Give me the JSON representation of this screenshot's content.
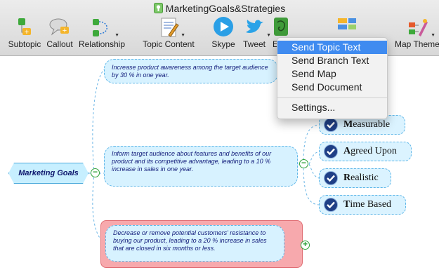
{
  "window": {
    "title": "MarketingGoals&Strategies"
  },
  "toolbar": {
    "items": [
      {
        "label": "Subtopic",
        "icon": "subtopic-icon"
      },
      {
        "label": "Callout",
        "icon": "callout-icon"
      },
      {
        "label": "Relationship",
        "icon": "relationship-icon"
      },
      {
        "label": "Topic Content",
        "icon": "topic-content-icon"
      },
      {
        "label": "Skype",
        "icon": "skype-icon"
      },
      {
        "label": "Tweet",
        "icon": "twitter-bird-icon"
      },
      {
        "label": "E",
        "icon": "evernote-icon"
      },
      {
        "label": "Map Theme",
        "icon": "map-theme-icon"
      }
    ]
  },
  "menu": {
    "items": [
      "Send Topic Text",
      "Send Branch Text",
      "Send Map",
      "Send Document"
    ],
    "settings": "Settings...",
    "highlighted": "Send Topic Text"
  },
  "mindmap": {
    "central": "Marketing Goals",
    "topics": [
      "Increase product awareness among the target audience by 30 % in one year.",
      "Inform target audience about features and benefits of our product and its competitive advantage, leading to a 10 % increase in sales in one year.",
      "Decrease or remove potential customers' resistance to buying our product, leading to a 20 % increase in sales that are closed in six months or less."
    ],
    "smart": [
      {
        "initial": "M",
        "rest": "easurable"
      },
      {
        "initial": "A",
        "rest": "greed Upon"
      },
      {
        "initial": "R",
        "rest": "ealistic"
      },
      {
        "initial": "T",
        "rest": "ime Based"
      }
    ]
  },
  "colors": {
    "menu_highlight": "#3f8bf0",
    "topic_fill": "#d7f2ff",
    "selected_frame": "#f7a9ad",
    "toggle_green": "#2ea13a"
  }
}
